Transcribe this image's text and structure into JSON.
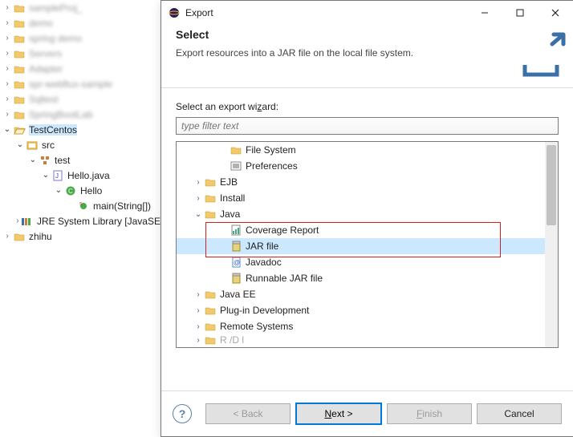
{
  "project_tree": {
    "blurred_items": [
      "sampleProj_",
      "demo",
      "spring demo",
      "Servers",
      "Adapter",
      "spr-webflux-sample",
      "Sqltest",
      "SpringBootLab"
    ],
    "selected_project": "TestCentos",
    "src_label": "src",
    "pkg_label": "test",
    "file_label": "Hello.java",
    "class_label": "Hello",
    "method_label": "main(String[])",
    "library_label": "JRE System Library [JavaSE",
    "extra_project": "zhihu"
  },
  "dialog": {
    "title": "Export",
    "heading": "Select",
    "description": "Export resources into a JAR file on the local file system.",
    "wizard_label_pre": "Select an export wi",
    "wizard_label_ul": "z",
    "wizard_label_post": "ard:",
    "filter_placeholder": "type filter text",
    "tree": [
      {
        "kind": "leaf",
        "indent": 3,
        "icon": "folder",
        "label": "File System"
      },
      {
        "kind": "leaf",
        "indent": 3,
        "icon": "prefs",
        "label": "Preferences"
      },
      {
        "kind": "collapsed",
        "indent": 1,
        "icon": "folder",
        "label": "EJB"
      },
      {
        "kind": "collapsed",
        "indent": 1,
        "icon": "folder",
        "label": "Install"
      },
      {
        "kind": "expanded",
        "indent": 1,
        "icon": "folder",
        "label": "Java"
      },
      {
        "kind": "leaf",
        "indent": 3,
        "icon": "report",
        "label": "Coverage Report"
      },
      {
        "kind": "leaf",
        "indent": 3,
        "icon": "jar",
        "label": "JAR file",
        "selected": true
      },
      {
        "kind": "leaf",
        "indent": 3,
        "icon": "javadoc",
        "label": "Javadoc"
      },
      {
        "kind": "leaf",
        "indent": 3,
        "icon": "jar",
        "label": "Runnable JAR file"
      },
      {
        "kind": "collapsed",
        "indent": 1,
        "icon": "folder",
        "label": "Java EE"
      },
      {
        "kind": "collapsed",
        "indent": 1,
        "icon": "folder",
        "label": "Plug-in Development"
      },
      {
        "kind": "collapsed",
        "indent": 1,
        "icon": "folder",
        "label": "Remote Systems"
      },
      {
        "kind": "collapsed-cut",
        "indent": 1,
        "icon": "folder",
        "label": "R   /D  l"
      }
    ],
    "buttons": {
      "back": "< Back",
      "next_pre": "N",
      "next_post": "ext >",
      "finish_pre": "F",
      "finish_post": "inish",
      "cancel": "Cancel"
    }
  }
}
